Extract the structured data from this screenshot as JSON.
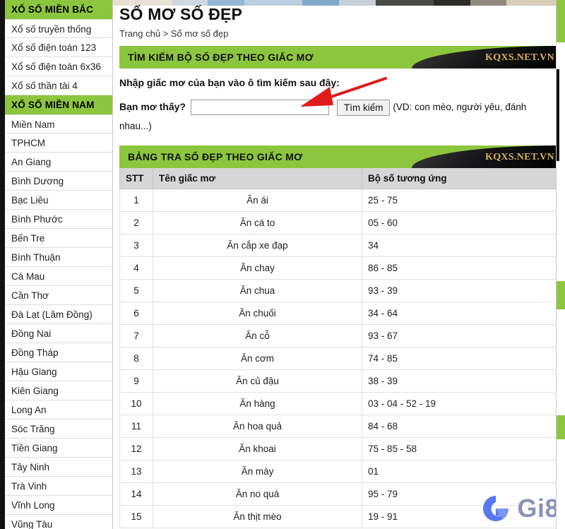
{
  "sidebar": {
    "sections": [
      {
        "heading": "XỔ SỐ MIỀN BẮC",
        "items": [
          "Xổ số truyền thống",
          "Xổ số điện toán 123",
          "Xổ số điện toán 6x36",
          "Xổ số thần tài 4"
        ]
      },
      {
        "heading": "XỔ SỐ MIỀN NAM",
        "items": [
          "Miền Nam",
          "TPHCM",
          "An Giang",
          "Bình Dương",
          "Bạc Liêu",
          "Bình Phước",
          "Bến Tre",
          "Bình Thuận",
          "Cà Mau",
          "Cần Thơ",
          "Đà Lạt (Lâm Đồng)",
          "Đồng Nai",
          "Đồng Tháp",
          "Hậu Giang",
          "Kiên Giang",
          "Long An",
          "Sóc Trăng",
          "Tiền Giang",
          "Tây Ninh",
          "Trà Vinh",
          "Vĩnh Long",
          "Vũng Tàu"
        ]
      }
    ]
  },
  "main": {
    "page_title": "SỔ MƠ SỐ ĐẸP",
    "breadcrumb": "Trang chủ > Sổ mơ số đẹp",
    "search_banner": {
      "title": "TÌM KIẾM BỘ SỐ ĐẸP THEO GIẤC MƠ",
      "brand": "KQXS.NET.VN"
    },
    "intro": "Nhập giấc mơ của bạn vào ô tìm kiếm sau đây:",
    "search": {
      "ask_label": "Bạn mơ thấy?",
      "input_value": "",
      "input_placeholder": "",
      "button_label": "Tìm kiếm",
      "hint": "(VD: con mèo, người yêu, đánh nhau...)"
    },
    "table_banner": {
      "title": "BẢNG TRA SỐ ĐẸP THEO GIẤC MƠ",
      "brand": "KQXS.NET.VN"
    },
    "table": {
      "columns": [
        "STT",
        "Tên giấc mơ",
        "Bộ số tương ứng"
      ],
      "rows": [
        [
          "1",
          "Ân ái",
          "25 - 75"
        ],
        [
          "2",
          "Ăn cá to",
          "05 - 60"
        ],
        [
          "3",
          "Ăn cắp xe đạp",
          "34"
        ],
        [
          "4",
          "Ăn chay",
          "86 - 85"
        ],
        [
          "5",
          "Ăn chua",
          "93 - 39"
        ],
        [
          "6",
          "Ăn chuối",
          "34 - 64"
        ],
        [
          "7",
          "Ăn cỗ",
          "93 - 67"
        ],
        [
          "8",
          "Ăn cơm",
          "74 - 85"
        ],
        [
          "9",
          "Ăn củ đậu",
          "38 - 39"
        ],
        [
          "10",
          "Ăn hàng",
          "03 - 04 - 52 - 19"
        ],
        [
          "11",
          "Ăn hoa quả",
          "84 - 68"
        ],
        [
          "12",
          "Ăn khoai",
          "75 - 85 - 58"
        ],
        [
          "13",
          "Ăn mày",
          "01"
        ],
        [
          "14",
          "Ăn no quá",
          "95 - 79"
        ],
        [
          "15",
          "Ăn thịt mèo",
          "19 - 91"
        ]
      ]
    }
  },
  "watermark": {
    "text": "Gi8",
    "logo": "g-logo-icon"
  },
  "annotations": {
    "arrow": "red-arrow-pointing-to-search-input"
  },
  "colors": {
    "brand_green": "#8cc63e",
    "banner_black": "#000000",
    "brand_gold": "#d8b15a",
    "arrow_red": "#e01b1b",
    "watermark_blue": "#4a6cf0",
    "watermark_gray": "#7f8ab4",
    "table_header_gray": "#d6d6d6"
  },
  "top_strip_colors": [
    "#e8e2d6",
    "#cfd9e4",
    "#93b7d4",
    "#b9cfe0",
    "#7fa9c9",
    "#c9cfd6",
    "#4a4a46",
    "#2b2b28",
    "#8f8a7e",
    "#d8cdb8"
  ]
}
